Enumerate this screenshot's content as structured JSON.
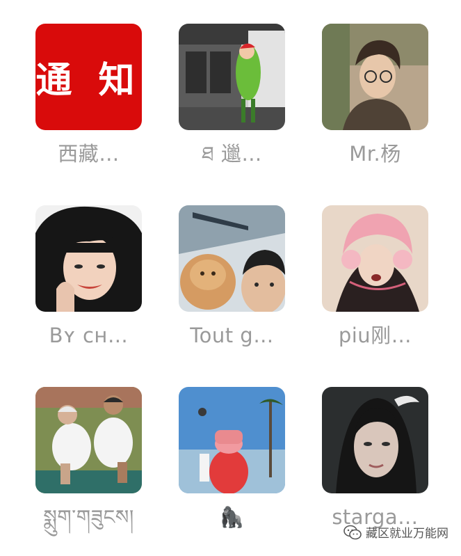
{
  "grid": {
    "items": [
      {
        "name": "西藏…",
        "avatar_text": "通 知",
        "icon": "notice-avatar"
      },
      {
        "name": "ཐ 邋…",
        "icon": "photo-avatar"
      },
      {
        "name": "Mr.杨",
        "icon": "photo-avatar"
      },
      {
        "name": "Bʏ ᴄʜ…",
        "icon": "photo-avatar"
      },
      {
        "name": "Tout g…",
        "icon": "photo-avatar"
      },
      {
        "name": "piu刚…",
        "icon": "photo-avatar"
      },
      {
        "name": "སྨུག་གཟུངས།",
        "icon": "photo-avatar"
      },
      {
        "name": "🦍",
        "icon": "photo-avatar"
      },
      {
        "name": "starga…",
        "icon": "photo-avatar"
      }
    ]
  },
  "watermark": {
    "text": "藏区就业万能网",
    "icon": "wechat-icon"
  },
  "colors": {
    "notice_red": "#d90b0b",
    "name_gray": "#9a9a9a"
  }
}
